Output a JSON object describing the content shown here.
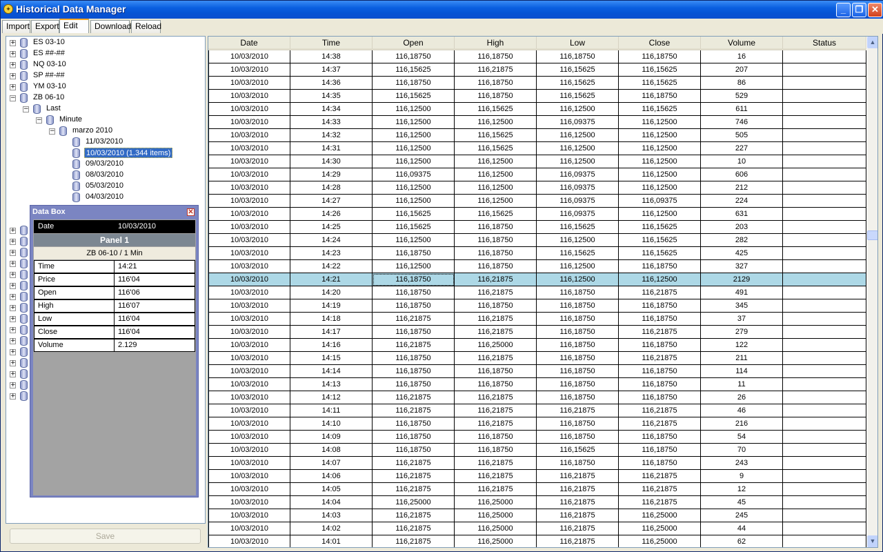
{
  "window": {
    "title": "Historical Data Manager"
  },
  "tabs": [
    "Import",
    "Export",
    "Edit",
    "Download",
    "Reload"
  ],
  "tree": {
    "symbols": [
      "ES 03-10",
      "ES ##-##",
      "NQ 03-10",
      "SP ##-##",
      "YM 03-10",
      "ZB 06-10"
    ],
    "last_label": "Last",
    "minute_label": "Minute",
    "month_label": "marzo 2010",
    "days": [
      "11/03/2010",
      "10/03/2010 (1.344 items)",
      "09/03/2010",
      "08/03/2010",
      "05/03/2010",
      "04/03/2010"
    ]
  },
  "save_label": "Save",
  "grid": {
    "columns": [
      "Date",
      "Time",
      "Open",
      "High",
      "Low",
      "Close",
      "Volume",
      "Status"
    ],
    "selected_time": "14:21",
    "rows": [
      [
        "10/03/2010",
        "14:38",
        "116,18750",
        "116,18750",
        "116,18750",
        "116,18750",
        "16",
        ""
      ],
      [
        "10/03/2010",
        "14:37",
        "116,15625",
        "116,21875",
        "116,15625",
        "116,15625",
        "207",
        ""
      ],
      [
        "10/03/2010",
        "14:36",
        "116,18750",
        "116,18750",
        "116,15625",
        "116,15625",
        "86",
        ""
      ],
      [
        "10/03/2010",
        "14:35",
        "116,15625",
        "116,18750",
        "116,15625",
        "116,18750",
        "529",
        ""
      ],
      [
        "10/03/2010",
        "14:34",
        "116,12500",
        "116,15625",
        "116,12500",
        "116,15625",
        "611",
        ""
      ],
      [
        "10/03/2010",
        "14:33",
        "116,12500",
        "116,12500",
        "116,09375",
        "116,12500",
        "746",
        ""
      ],
      [
        "10/03/2010",
        "14:32",
        "116,12500",
        "116,15625",
        "116,12500",
        "116,12500",
        "505",
        ""
      ],
      [
        "10/03/2010",
        "14:31",
        "116,12500",
        "116,15625",
        "116,12500",
        "116,12500",
        "227",
        ""
      ],
      [
        "10/03/2010",
        "14:30",
        "116,12500",
        "116,12500",
        "116,12500",
        "116,12500",
        "10",
        ""
      ],
      [
        "10/03/2010",
        "14:29",
        "116,09375",
        "116,12500",
        "116,09375",
        "116,12500",
        "606",
        ""
      ],
      [
        "10/03/2010",
        "14:28",
        "116,12500",
        "116,12500",
        "116,09375",
        "116,12500",
        "212",
        ""
      ],
      [
        "10/03/2010",
        "14:27",
        "116,12500",
        "116,12500",
        "116,09375",
        "116,09375",
        "224",
        ""
      ],
      [
        "10/03/2010",
        "14:26",
        "116,15625",
        "116,15625",
        "116,09375",
        "116,12500",
        "631",
        ""
      ],
      [
        "10/03/2010",
        "14:25",
        "116,15625",
        "116,18750",
        "116,15625",
        "116,15625",
        "203",
        ""
      ],
      [
        "10/03/2010",
        "14:24",
        "116,12500",
        "116,18750",
        "116,12500",
        "116,15625",
        "282",
        ""
      ],
      [
        "10/03/2010",
        "14:23",
        "116,18750",
        "116,18750",
        "116,15625",
        "116,15625",
        "425",
        ""
      ],
      [
        "10/03/2010",
        "14:22",
        "116,12500",
        "116,18750",
        "116,12500",
        "116,18750",
        "327",
        ""
      ],
      [
        "10/03/2010",
        "14:21",
        "116,18750",
        "116,21875",
        "116,12500",
        "116,12500",
        "2129",
        ""
      ],
      [
        "10/03/2010",
        "14:20",
        "116,18750",
        "116,21875",
        "116,18750",
        "116,21875",
        "491",
        ""
      ],
      [
        "10/03/2010",
        "14:19",
        "116,18750",
        "116,18750",
        "116,18750",
        "116,18750",
        "345",
        ""
      ],
      [
        "10/03/2010",
        "14:18",
        "116,21875",
        "116,21875",
        "116,18750",
        "116,18750",
        "37",
        ""
      ],
      [
        "10/03/2010",
        "14:17",
        "116,18750",
        "116,21875",
        "116,18750",
        "116,21875",
        "279",
        ""
      ],
      [
        "10/03/2010",
        "14:16",
        "116,21875",
        "116,25000",
        "116,18750",
        "116,18750",
        "122",
        ""
      ],
      [
        "10/03/2010",
        "14:15",
        "116,18750",
        "116,21875",
        "116,18750",
        "116,21875",
        "211",
        ""
      ],
      [
        "10/03/2010",
        "14:14",
        "116,18750",
        "116,18750",
        "116,18750",
        "116,18750",
        "114",
        ""
      ],
      [
        "10/03/2010",
        "14:13",
        "116,18750",
        "116,18750",
        "116,18750",
        "116,18750",
        "11",
        ""
      ],
      [
        "10/03/2010",
        "14:12",
        "116,21875",
        "116,21875",
        "116,18750",
        "116,18750",
        "26",
        ""
      ],
      [
        "10/03/2010",
        "14:11",
        "116,21875",
        "116,21875",
        "116,21875",
        "116,21875",
        "46",
        ""
      ],
      [
        "10/03/2010",
        "14:10",
        "116,18750",
        "116,21875",
        "116,18750",
        "116,21875",
        "216",
        ""
      ],
      [
        "10/03/2010",
        "14:09",
        "116,18750",
        "116,18750",
        "116,18750",
        "116,18750",
        "54",
        ""
      ],
      [
        "10/03/2010",
        "14:08",
        "116,18750",
        "116,18750",
        "116,15625",
        "116,18750",
        "70",
        ""
      ],
      [
        "10/03/2010",
        "14:07",
        "116,21875",
        "116,21875",
        "116,18750",
        "116,18750",
        "243",
        ""
      ],
      [
        "10/03/2010",
        "14:06",
        "116,21875",
        "116,21875",
        "116,21875",
        "116,21875",
        "9",
        ""
      ],
      [
        "10/03/2010",
        "14:05",
        "116,21875",
        "116,21875",
        "116,21875",
        "116,21875",
        "12",
        ""
      ],
      [
        "10/03/2010",
        "14:04",
        "116,25000",
        "116,25000",
        "116,21875",
        "116,21875",
        "45",
        ""
      ],
      [
        "10/03/2010",
        "14:03",
        "116,21875",
        "116,25000",
        "116,21875",
        "116,25000",
        "245",
        ""
      ],
      [
        "10/03/2010",
        "14:02",
        "116,21875",
        "116,25000",
        "116,21875",
        "116,25000",
        "44",
        ""
      ],
      [
        "10/03/2010",
        "14:01",
        "116,21875",
        "116,25000",
        "116,21875",
        "116,25000",
        "62",
        ""
      ]
    ]
  },
  "databox": {
    "title": "Data Box",
    "date_label": "Date",
    "date_value": "10/03/2010",
    "panel_label": "Panel 1",
    "symbol_label": "ZB 06-10 / 1 Min",
    "rows": [
      {
        "label": "Time",
        "value": "14:21"
      },
      {
        "label": "Price",
        "value": "116'04"
      },
      {
        "label": "Open",
        "value": "116'06"
      },
      {
        "label": "High",
        "value": "116'07"
      },
      {
        "label": "Low",
        "value": "116'04"
      },
      {
        "label": "Close",
        "value": "116'04"
      },
      {
        "label": "Volume",
        "value": "2.129"
      }
    ]
  },
  "icons": {
    "app": "app-icon",
    "database": "database-icon",
    "expand": "plus-box-icon",
    "collapse": "minus-box-icon",
    "close": "close-icon"
  },
  "colors": {
    "selected_row": "#add8e6",
    "tree_selection": "#316ac5",
    "titlebar": "#0653d4",
    "databox_border": "#7b85c2"
  }
}
